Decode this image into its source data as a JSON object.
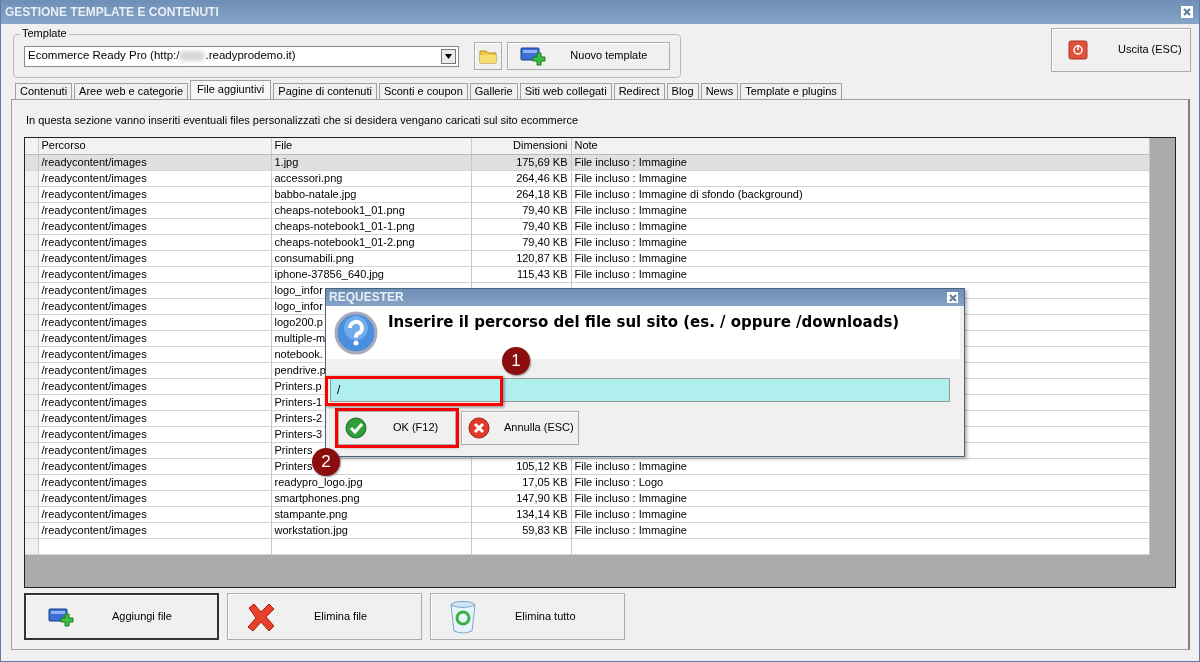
{
  "window": {
    "title": "GESTIONE TEMPLATE E CONTENUTI"
  },
  "template": {
    "legend": "Template",
    "value_start": "Ecommerce Ready Pro (http:/",
    "value_end": ".readyprodemo.it)",
    "new_button": "Nuovo template"
  },
  "exit_button": "Uscita (ESC)",
  "tabs": [
    {
      "label": "Contenuti",
      "selected": false
    },
    {
      "label": "Aree web e categorie",
      "selected": false
    },
    {
      "label": "File aggiuntivi",
      "selected": true
    },
    {
      "label": "Pagine di contenuti",
      "selected": false
    },
    {
      "label": "Sconti e coupon",
      "selected": false
    },
    {
      "label": "Gallerie",
      "selected": false
    },
    {
      "label": "Siti web collegati",
      "selected": false
    },
    {
      "label": "Redirect",
      "selected": false
    },
    {
      "label": "Blog",
      "selected": false
    },
    {
      "label": "News",
      "selected": false
    },
    {
      "label": "Template e plugins",
      "selected": false
    }
  ],
  "info": "In questa sezione vanno inseriti eventuali files personalizzati che si desidera vengano caricati sul sito ecommerce",
  "table": {
    "columns": [
      "Percorso",
      "File",
      "Dimensioni",
      "Note"
    ],
    "rows": [
      {
        "path": "/readycontent/images",
        "file": "1.jpg",
        "size": "175,69 KB",
        "note": "File incluso : Immagine",
        "selected": true
      },
      {
        "path": "/readycontent/images",
        "file": "accessori.png",
        "size": "264,46 KB",
        "note": "File incluso : Immagine",
        "selected": false
      },
      {
        "path": "/readycontent/images",
        "file": "babbo-natale.jpg",
        "size": "264,18 KB",
        "note": "File incluso : Immagine di sfondo (background)",
        "selected": false
      },
      {
        "path": "/readycontent/images",
        "file": "cheaps-notebook1_01.png",
        "size": "79,40 KB",
        "note": "File incluso : Immagine",
        "selected": false
      },
      {
        "path": "/readycontent/images",
        "file": "cheaps-notebook1_01-1.png",
        "size": "79,40 KB",
        "note": "File incluso : Immagine",
        "selected": false
      },
      {
        "path": "/readycontent/images",
        "file": "cheaps-notebook1_01-2.png",
        "size": "79,40 KB",
        "note": "File incluso : Immagine",
        "selected": false
      },
      {
        "path": "/readycontent/images",
        "file": "consumabili.png",
        "size": "120,87 KB",
        "note": "File incluso : Immagine",
        "selected": false
      },
      {
        "path": "/readycontent/images",
        "file": "iphone-37856_640.jpg",
        "size": "115,43 KB",
        "note": "File incluso : Immagine",
        "selected": false
      },
      {
        "path": "/readycontent/images",
        "file": "logo_infor",
        "selected": false
      },
      {
        "path": "/readycontent/images",
        "file": "logo_infor",
        "selected": false
      },
      {
        "path": "/readycontent/images",
        "file": "logo200.p",
        "selected": false
      },
      {
        "path": "/readycontent/images",
        "file": "multiple-m",
        "selected": false
      },
      {
        "path": "/readycontent/images",
        "file": "notebook.",
        "selected": false
      },
      {
        "path": "/readycontent/images",
        "file": "pendrive.p",
        "selected": false
      },
      {
        "path": "/readycontent/images",
        "file": "Printers.p",
        "selected": false
      },
      {
        "path": "/readycontent/images",
        "file": "Printers-1",
        "selected": false
      },
      {
        "path": "/readycontent/images",
        "file": "Printers-2",
        "selected": false
      },
      {
        "path": "/readycontent/images",
        "file": "Printers-3",
        "selected": false
      },
      {
        "path": "/readycontent/images",
        "file": "Printers",
        "selected": false
      },
      {
        "path": "/readycontent/images",
        "file": "Printers",
        "size": "105,12 KB",
        "note": "File incluso : Immagine",
        "selected": false
      },
      {
        "path": "/readycontent/images",
        "file": "readypro_logo.jpg",
        "size": "17,05 KB",
        "note": "File incluso : Logo",
        "selected": false
      },
      {
        "path": "/readycontent/images",
        "file": "smartphones.png",
        "size": "147,90 KB",
        "note": "File incluso : Immagine",
        "selected": false
      },
      {
        "path": "/readycontent/images",
        "file": "stampante.png",
        "size": "134,14 KB",
        "note": "File incluso : Immagine",
        "selected": false
      },
      {
        "path": "/readycontent/images",
        "file": "workstation.jpg",
        "size": "59,83 KB",
        "note": "File incluso : Immagine",
        "selected": false
      }
    ]
  },
  "bottom_buttons": [
    {
      "label": "Aggiungi file",
      "kind": "add"
    },
    {
      "label": "Elimina file",
      "kind": "delete"
    },
    {
      "label": "Elimina tutto",
      "kind": "trash"
    }
  ],
  "dialog": {
    "title": "REQUESTER",
    "question": "Inserire il percorso del file sul sito (es. / oppure /downloads)",
    "value": "/",
    "buttons": [
      {
        "label": "OK (F12)",
        "kind": "ok",
        "highlighted": true
      },
      {
        "label": "Annulla (ESC)",
        "kind": "cancel",
        "highlighted": false
      }
    ]
  },
  "callouts": [
    {
      "number": "1"
    },
    {
      "number": "2"
    }
  ]
}
